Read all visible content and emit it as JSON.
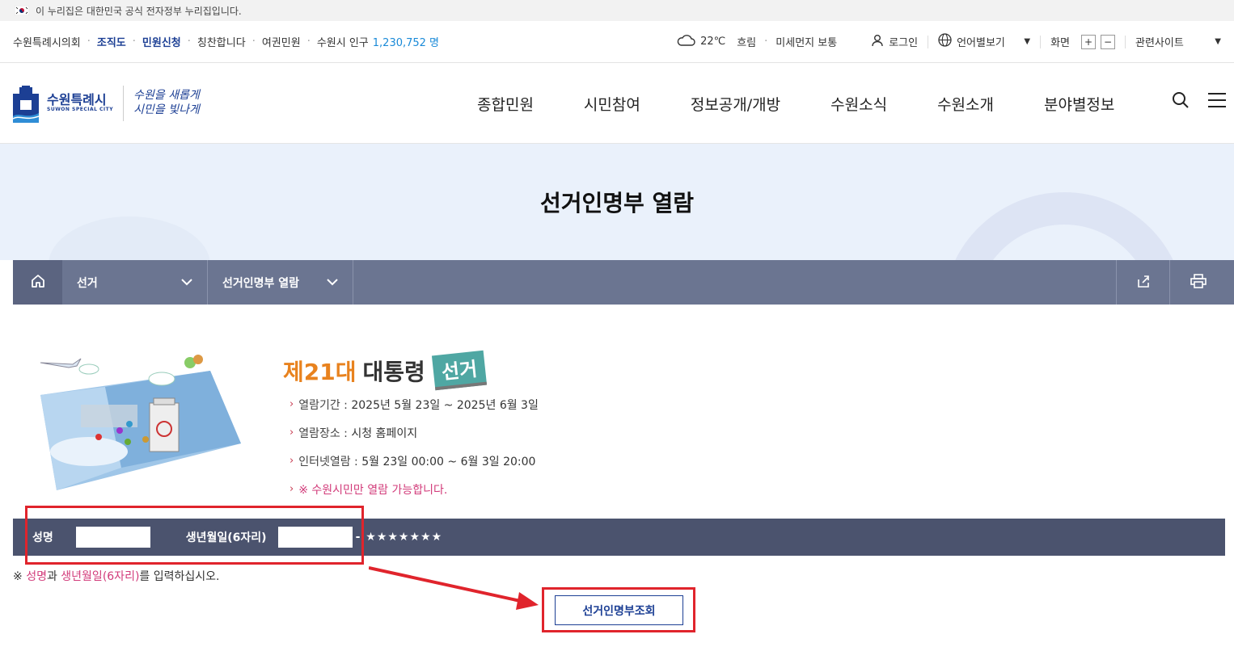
{
  "gov_banner": "이 누리집은 대한민국 공식 전자정부 누리집입니다.",
  "util_left": {
    "council": "수원특례시의회",
    "org": "조직도",
    "civil": "민원신청",
    "praise": "칭찬합니다",
    "passport": "여권민원",
    "population_label": "수원시 인구",
    "population_value": "1,230,752 명"
  },
  "weather": {
    "temp": "22℃",
    "condition": "흐림",
    "dust": "미세먼지 보통"
  },
  "util_right": {
    "login": "로그인",
    "language": "언어별보기",
    "screen": "화면",
    "zoom_in": "+",
    "zoom_out": "−",
    "related": "관련사이트"
  },
  "logo": {
    "name": "수원특례시",
    "sub": "SUWON SPECIAL CITY",
    "slogan_line1": "수원을 새롭게",
    "slogan_line2": "시민을 빛나게"
  },
  "gnb": [
    "종합민원",
    "시민참여",
    "정보공개/개방",
    "수원소식",
    "수원소개",
    "분야별정보"
  ],
  "page_title": "선거인명부 열람",
  "breadcrumb": {
    "level1": "선거",
    "level2": "선거인명부 열람"
  },
  "election": {
    "number": "제21대",
    "title": "대통령",
    "badge": "선거",
    "period_label": "열람기간 :",
    "period_value": "2025년 5월 23일 ~ 2025년 6월 3일",
    "place_label": "열람장소 :",
    "place_value": "시청 홈페이지",
    "internet_label": "인터넷열람 :",
    "internet_value": "5월 23일 00:00 ~ 6월 3일 20:00",
    "note": "※ 수원시민만 열람 가능합니다."
  },
  "form": {
    "name_label": "성명",
    "birth_label": "생년월일(6자리)",
    "mask": "- ★★★★★★★",
    "help_prefix": "※ ",
    "help_name": "성명",
    "help_mid": "과 ",
    "help_birth": "생년월일(6자리)",
    "help_suffix": "를 입력하십시오.",
    "submit": "선거인명부조회"
  }
}
